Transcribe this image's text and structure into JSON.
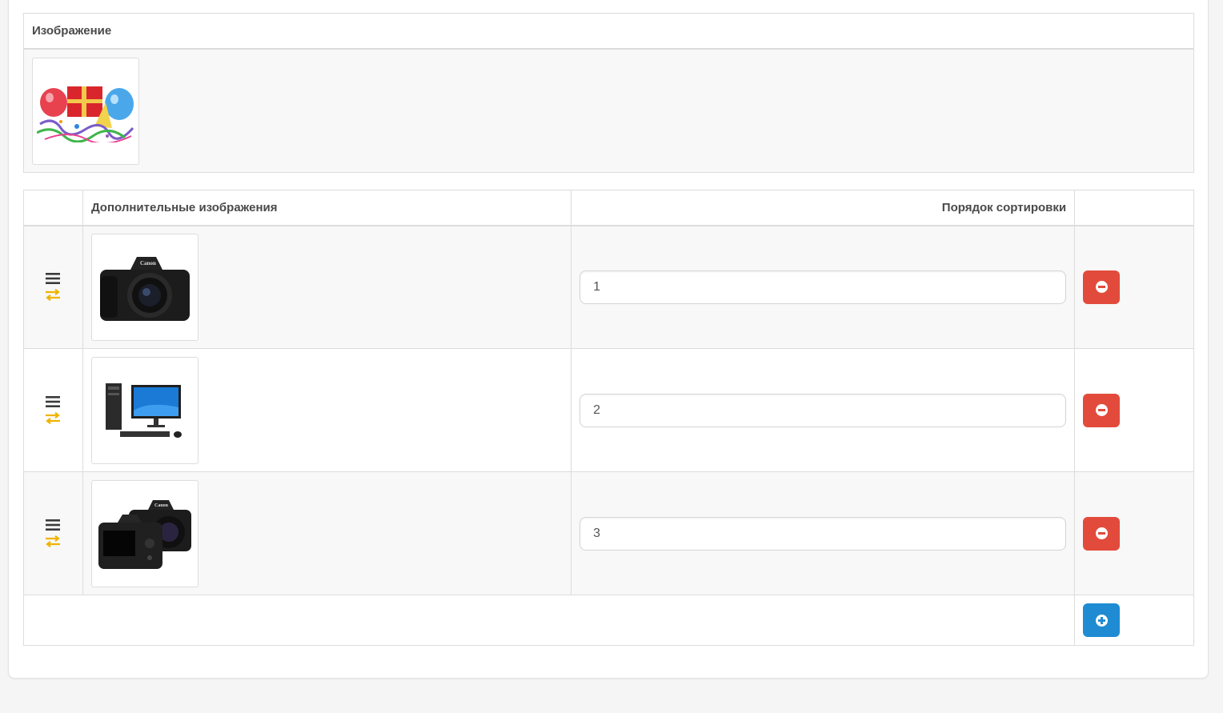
{
  "main_image": {
    "header": "Изображение",
    "thumb_icon": "party-balloons-gift-image"
  },
  "additional_images": {
    "header_images": "Дополнительные изображения",
    "header_sort": "Порядок сортировки",
    "rows": [
      {
        "thumb_icon": "canon-dslr-camera-front-image",
        "sort_order": "1"
      },
      {
        "thumb_icon": "desktop-computer-set-image",
        "sort_order": "2"
      },
      {
        "thumb_icon": "canon-dslr-camera-back-image",
        "sort_order": "3"
      }
    ]
  },
  "colors": {
    "danger": "#e24b3b",
    "primary": "#1e8bd3",
    "swap_icon": "#f0b400",
    "handle_icon": "#3a3a3a"
  },
  "icons": {
    "drag": "bars-icon",
    "swap": "exchange-arrows-icon",
    "remove": "minus-circle-icon",
    "add": "plus-circle-icon"
  }
}
